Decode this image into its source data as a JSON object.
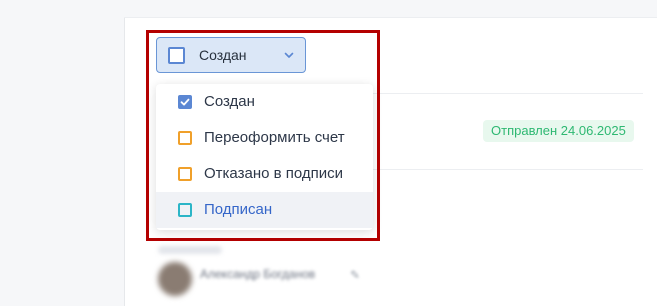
{
  "status_select": {
    "label": "Создан",
    "checkbox_icon": "square-checkbox-icon",
    "chevron_icon": "chevron-down-icon"
  },
  "dropdown": {
    "options": [
      {
        "label": "Создан",
        "checked": true,
        "color": "#5b87d3",
        "label_color": "#2d3748"
      },
      {
        "label": "Переоформить счет",
        "checked": false,
        "color": "#f0a02a",
        "label_color": "#2d3748"
      },
      {
        "label": "Отказано в подписи",
        "checked": false,
        "color": "#f0a02a",
        "label_color": "#2d3748"
      },
      {
        "label": "Подписан",
        "checked": false,
        "color": "#2bb5c7",
        "label_color": "#3566c9",
        "highlighted": true
      }
    ]
  },
  "status_badge": {
    "text": "Отправлен 24.06.2025",
    "color": "#2eb872",
    "background": "#e8f8ee"
  },
  "assignee": {
    "name": "Александр Богданов",
    "edit_icon": "pencil-icon"
  },
  "colors": {
    "focus_frame": "#b40000",
    "select_background": "#dbe7f7",
    "select_border": "#6a96d6"
  }
}
